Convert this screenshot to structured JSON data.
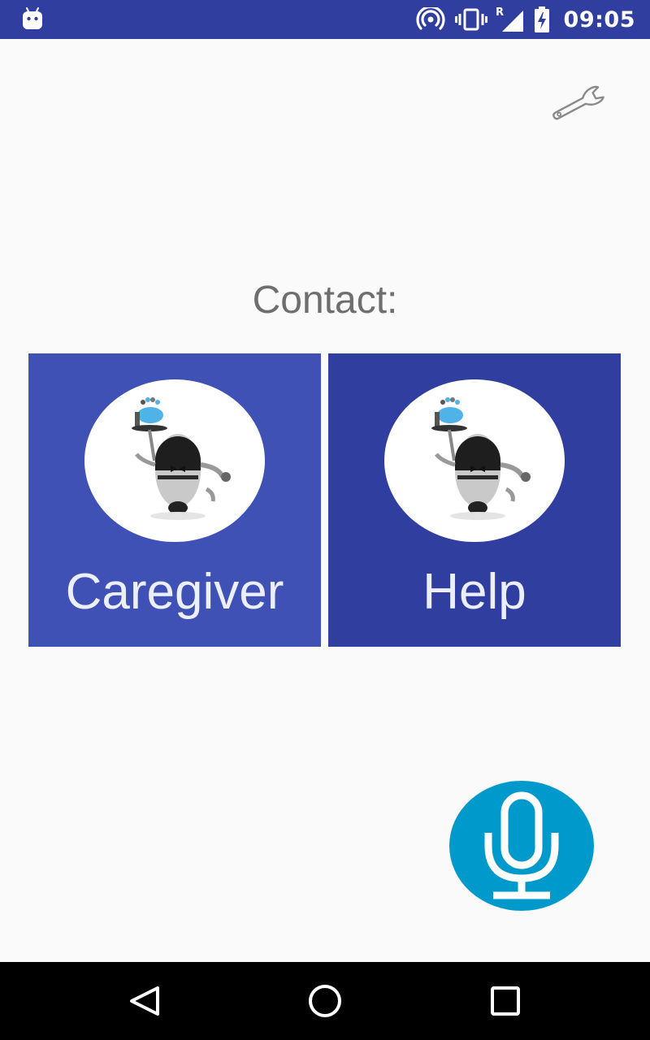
{
  "status_bar": {
    "time": "09:05",
    "notification_icon": "android-debug-icon",
    "icons": [
      "hotspot-icon",
      "vibrate-icon",
      "signal-roaming-icon",
      "battery-charging-icon"
    ],
    "roaming_indicator": "R"
  },
  "toolbar": {
    "settings_icon": "wrench-icon"
  },
  "contact": {
    "heading": "Contact:",
    "tiles": [
      {
        "label": "Caregiver",
        "image": "robot-butler-image",
        "color": "#3f51b5"
      },
      {
        "label": "Help",
        "image": "robot-butler-image",
        "color": "#303f9f"
      }
    ]
  },
  "voice": {
    "icon": "microphone-icon",
    "color": "#0099cc"
  },
  "nav_bar": {
    "buttons": [
      "back-icon",
      "home-icon",
      "recents-icon"
    ]
  }
}
